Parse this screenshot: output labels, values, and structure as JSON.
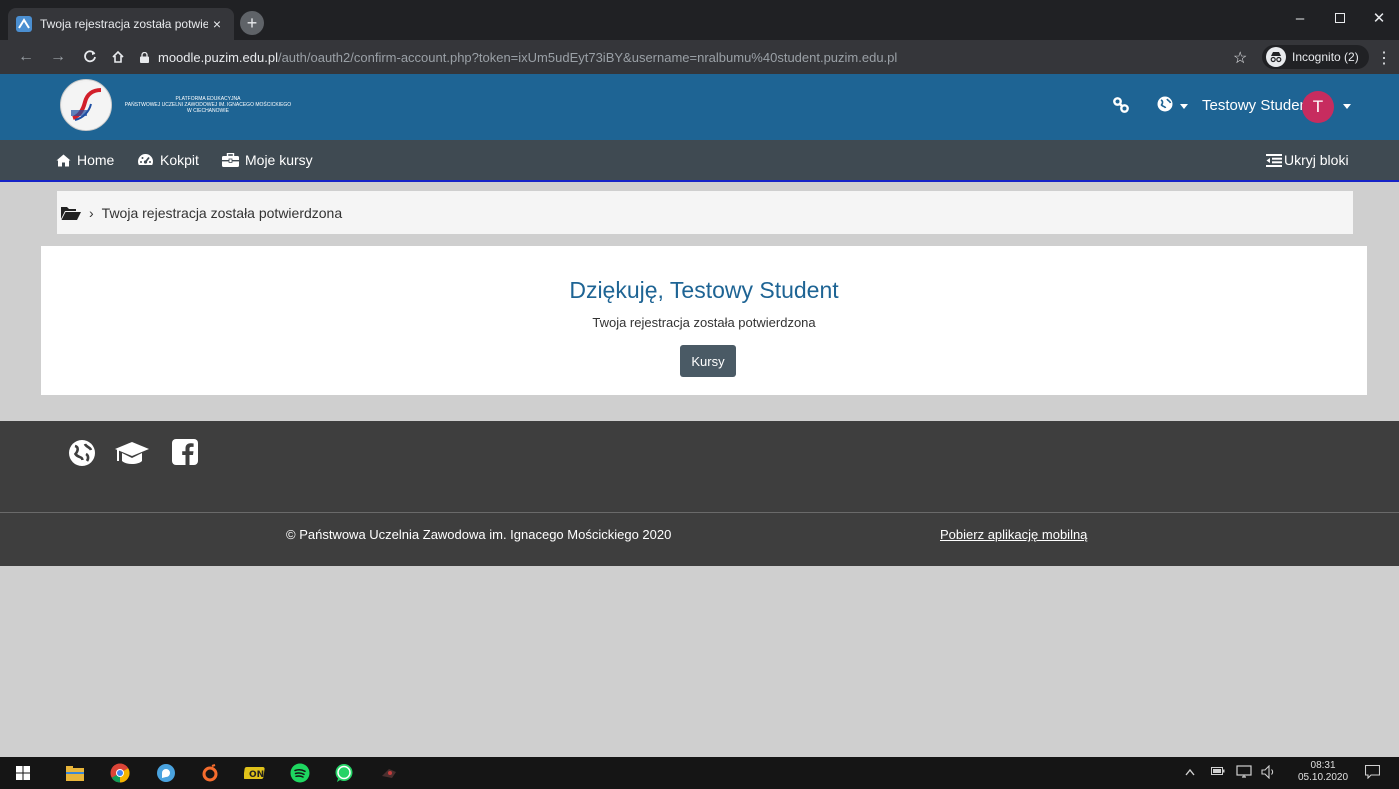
{
  "browser": {
    "tab_title": "Twoja rejestracja została potwierd",
    "tab_close": "×",
    "new_tab": "+",
    "url_host": "moodle.puzim.edu.pl",
    "url_path": "/auth/oauth2/confirm-account.php?token=ixUm5udEyt73iBY&username=nralbumu%40student.puzim.edu.pl",
    "incognito_label": "Incognito (2)"
  },
  "header": {
    "logo_line1": "PLATFORMA EDUKACYJNA",
    "logo_line2": "PAŃSTWOWEJ UCZELNI ZAWODOWEJ IM. IGNACEGO MOŚCICKIEGO",
    "logo_line3": "W CIECHANOWIE",
    "user_name": "Testowy Student",
    "avatar_initial": "T"
  },
  "nav": {
    "home": "Home",
    "dashboard": "Kokpit",
    "my_courses": "Moje kursy",
    "hide_blocks": "Ukryj bloki"
  },
  "breadcrumb": {
    "separator": "›",
    "current": "Twoja rejestracja została potwierdzona"
  },
  "main": {
    "heading": "Dziękuję, Testowy Student",
    "message": "Twoja rejestracja została potwierdzona",
    "button": "Kursy"
  },
  "footer": {
    "copyright": "© Państwowa Uczelnia Zawodowa im. Ignacego Mościckiego 2020",
    "app_link": "Pobierz aplikację mobilną"
  },
  "taskbar": {
    "time": "08:31",
    "date": "05.10.2020"
  },
  "colors": {
    "header_blue": "#1e6494",
    "nav_gray": "#3f4a52",
    "avatar_pink": "#c72c5f",
    "footer_dark": "#3e3e3e",
    "button_slate": "#4a5a65"
  }
}
